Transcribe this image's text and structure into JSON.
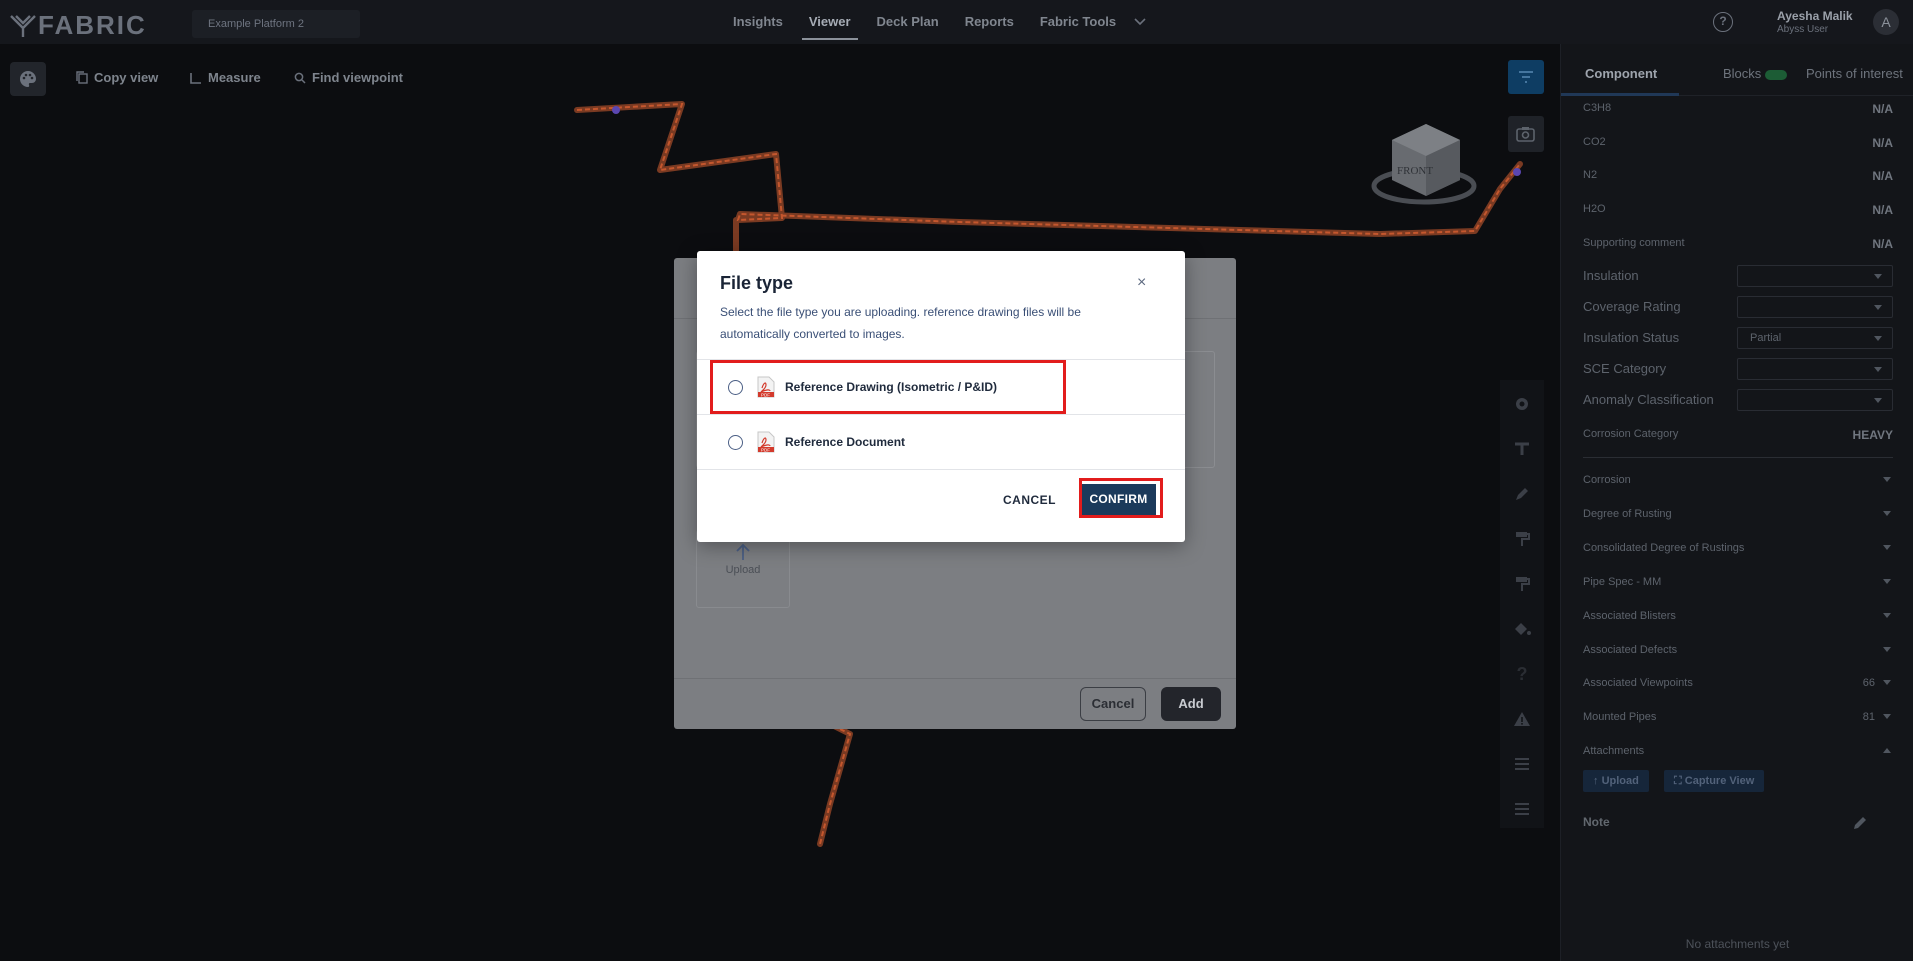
{
  "app": {
    "brand": "FABRIC",
    "platform": "Example Platform 2"
  },
  "nav": {
    "items": [
      {
        "label": "Insights"
      },
      {
        "label": "Viewer"
      },
      {
        "label": "Deck Plan"
      },
      {
        "label": "Reports"
      },
      {
        "label": "Fabric Tools"
      }
    ],
    "active": "Viewer"
  },
  "user": {
    "name": "Ayesha Malik",
    "role": "Abyss User",
    "initial": "A"
  },
  "toolbar": {
    "copy_view": "Copy view",
    "measure": "Measure",
    "find_viewpoint": "Find viewpoint"
  },
  "scene": {
    "view_cube_label": "FRONT"
  },
  "panel": {
    "tabs": {
      "component": "Component",
      "blocks": "Blocks",
      "points": "Points of interest"
    },
    "props": [
      {
        "label": "C3H8",
        "value": "N/A"
      },
      {
        "label": "CO2",
        "value": "N/A"
      },
      {
        "label": "N2",
        "value": "N/A"
      },
      {
        "label": "H2O",
        "value": "N/A"
      },
      {
        "label": "Supporting comment",
        "value": "N/A"
      }
    ],
    "selects": [
      {
        "label": "Insulation",
        "value": ""
      },
      {
        "label": "Coverage Rating",
        "value": ""
      },
      {
        "label": "Insulation Status",
        "value": "Partial"
      },
      {
        "label": "SCE Category",
        "value": ""
      },
      {
        "label": "Anomaly Classification",
        "value": ""
      }
    ],
    "corrosion_category": {
      "label": "Corrosion Category",
      "value": "HEAVY"
    },
    "sections": [
      {
        "label": "Corrosion",
        "count": ""
      },
      {
        "label": "Degree of Rusting",
        "count": ""
      },
      {
        "label": "Consolidated Degree of Rustings",
        "count": ""
      },
      {
        "label": "Pipe Spec - MM",
        "count": ""
      },
      {
        "label": "Associated Blisters",
        "count": ""
      },
      {
        "label": "Associated Defects",
        "count": ""
      },
      {
        "label": "Associated Viewpoints",
        "count": "66"
      },
      {
        "label": "Mounted Pipes",
        "count": "81"
      },
      {
        "label": "Attachments",
        "count": ""
      }
    ],
    "upload_btn": "Upload",
    "capture_btn": "Capture View",
    "note_label": "Note",
    "empty_text": "No attachments yet"
  },
  "bg_modal": {
    "upload_label": "Upload",
    "cancel": "Cancel",
    "add": "Add"
  },
  "dialog": {
    "title": "File type",
    "description": "Select the file type you are uploading. reference drawing files will be automatically converted to images.",
    "options": [
      {
        "label": "Reference Drawing (Isometric / P&ID)",
        "selected": false
      },
      {
        "label": "Reference Document",
        "selected": false
      }
    ],
    "cancel": "CANCEL",
    "confirm": "CONFIRM",
    "pdf_badge": "PDF"
  },
  "colors": {
    "highlight": "#e21c1c",
    "confirm_bg": "#1b3a5b",
    "pipe": "#c4572e"
  }
}
